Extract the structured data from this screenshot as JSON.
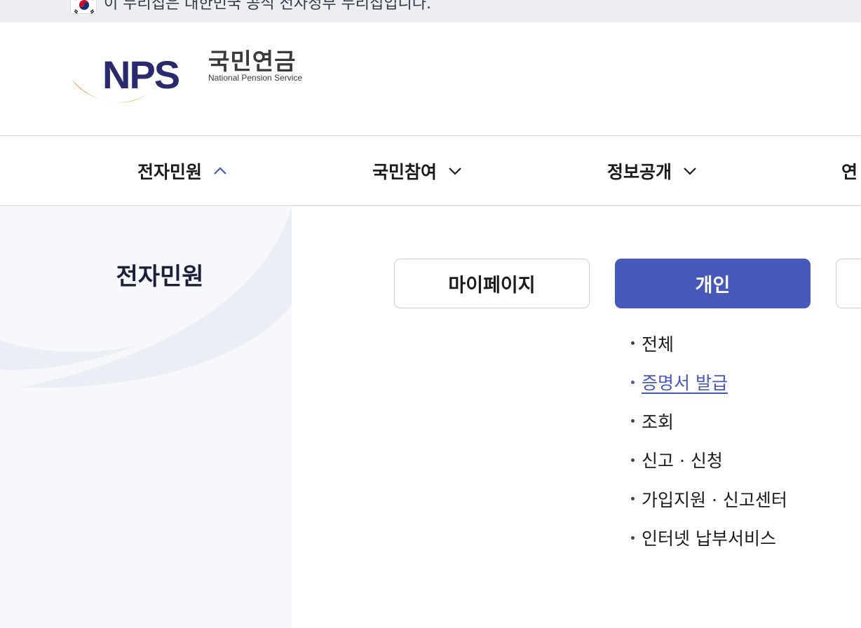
{
  "gov_banner": {
    "text": "이 누리집은 대한민국 공식 전자정부 누리집입니다."
  },
  "logo": {
    "mark_text": "NPS",
    "name_ko": "국민연금",
    "name_en": "National Pension Service"
  },
  "gnb": {
    "items": [
      {
        "label": "전자민원",
        "state": "expanded",
        "icon": "chevron-up-icon"
      },
      {
        "label": "국민참여",
        "state": "collapsed",
        "icon": "chevron-down-icon"
      },
      {
        "label": "정보공개",
        "state": "collapsed",
        "icon": "chevron-down-icon"
      },
      {
        "label": "연"
      }
    ]
  },
  "side": {
    "title": "전자민원"
  },
  "tabs": [
    {
      "label": "마이페이지",
      "selected": false
    },
    {
      "label": "개인",
      "selected": true
    }
  ],
  "sub_menu": [
    {
      "label": "전체",
      "active": false
    },
    {
      "label": "증명서 발급",
      "active": true
    },
    {
      "label": "조회",
      "active": false
    },
    {
      "label": "신고 · 신청",
      "active": false
    },
    {
      "label": "가입지원 · 신고센터",
      "active": false
    },
    {
      "label": "인터넷 납부서비스",
      "active": false
    }
  ],
  "colors": {
    "accent": "#4758b8",
    "navy": "#2b2a6e",
    "banner_bg": "#eceef2",
    "side_bg": "#f7f8fb"
  }
}
